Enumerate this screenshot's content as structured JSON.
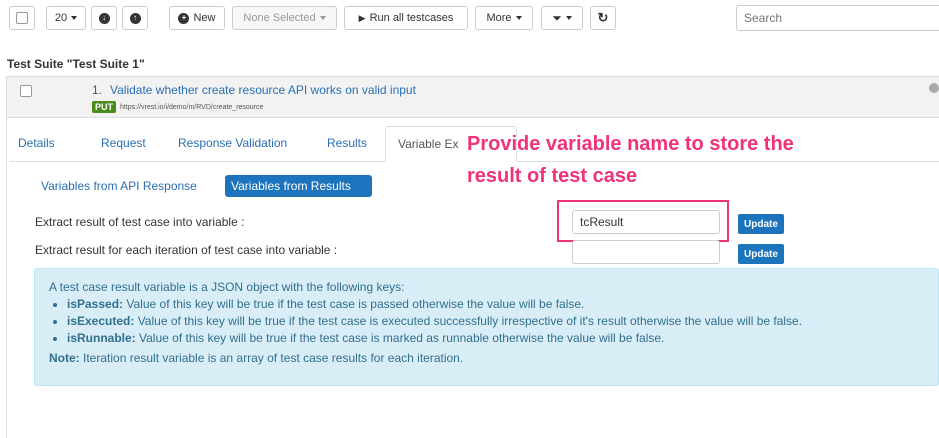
{
  "toolbar": {
    "page_size": "20",
    "new_label": "New",
    "none_selected_label": "None Selected",
    "run_all_label": "Run all testcases",
    "more_label": "More",
    "search_placeholder": "Search"
  },
  "suite": {
    "title": "Test Suite \"Test Suite 1\""
  },
  "testcase": {
    "number": "1.",
    "title": "Validate whether create resource API works on valid input",
    "method": "PUT",
    "url": "https://vrest.io/i/demo/m/RVD/create_resource"
  },
  "tabs": [
    {
      "label": "Details"
    },
    {
      "label": "Request"
    },
    {
      "label": "Response Validation"
    },
    {
      "label": "Results"
    },
    {
      "label": "Variable Ex"
    }
  ],
  "subtabs": [
    {
      "label": "Variables from API Response"
    },
    {
      "label": "Variables from Results"
    }
  ],
  "form": {
    "row1_label": "Extract result of test case into variable :",
    "row1_value": "tcResult",
    "row2_label": "Extract result for each iteration of test case into variable :",
    "row2_value": "",
    "update_label": "Update"
  },
  "info": {
    "intro": "A test case result variable is a JSON object with the following keys:",
    "items": [
      {
        "key": "isPassed:",
        "text": " Value of this key will be true if the test case is passed otherwise the value will be false."
      },
      {
        "key": "isExecuted:",
        "text": " Value of this key will be true if the test case is executed successfully irrespective of it's result otherwise the value will be false."
      },
      {
        "key": "isRunnable:",
        "text": " Value of this key will be true if the test case is marked as runnable otherwise the value will be false."
      }
    ],
    "note_key": "Note:",
    "note_text": " Iteration result variable is an array of test case results for each iteration."
  },
  "callout": {
    "line1": "Provide variable name to store the",
    "line2": "result of test case",
    "color": "#f0327a"
  },
  "colors": {
    "link": "#2a6fb5",
    "primary": "#1c74bd",
    "put_badge": "#4b8b1d",
    "info_bg": "#d9edf7"
  }
}
